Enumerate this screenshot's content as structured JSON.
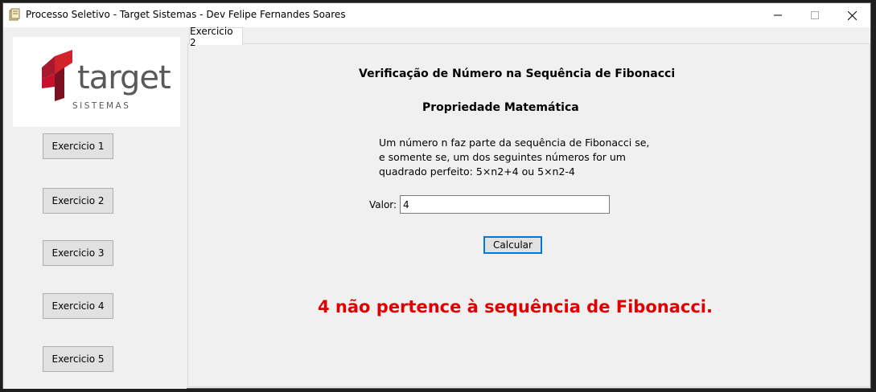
{
  "window": {
    "title": "Processo Seletivo - Target Sistemas - Dev Felipe Fernandes Soares",
    "icon": "app-folder-icon",
    "controls": [
      "minimize-icon",
      "maximize-icon",
      "close-icon"
    ]
  },
  "sidebar": {
    "logo": {
      "brand": "target",
      "tagline": "SISTEMAS"
    },
    "buttons": [
      {
        "label": "Exercicio 1"
      },
      {
        "label": "Exercicio 2"
      },
      {
        "label": "Exercicio 3"
      },
      {
        "label": "Exercicio 4"
      },
      {
        "label": "Exercicio 5"
      }
    ]
  },
  "tabs": [
    {
      "label": "Exercicio 2",
      "selected": true
    }
  ],
  "content": {
    "title": "Verificação de Número na Sequência de Fibonacci",
    "subtitle": "Propriedade Matemática",
    "description": [
      "Um número n faz parte da sequência de Fibonacci se,",
      "e somente se, um dos seguintes números for um",
      "quadrado perfeito: 5×n2+4 ou 5×n2-4"
    ],
    "valor_label": "Valor:",
    "valor_value": "4",
    "calc_label": "Calcular",
    "result": "4 não pertence à sequência de Fibonacci.",
    "result_color": "#e00000"
  },
  "colors": {
    "accent": "#0078d7",
    "logo_red": "#c8102e",
    "logo_gray": "#58595b"
  }
}
